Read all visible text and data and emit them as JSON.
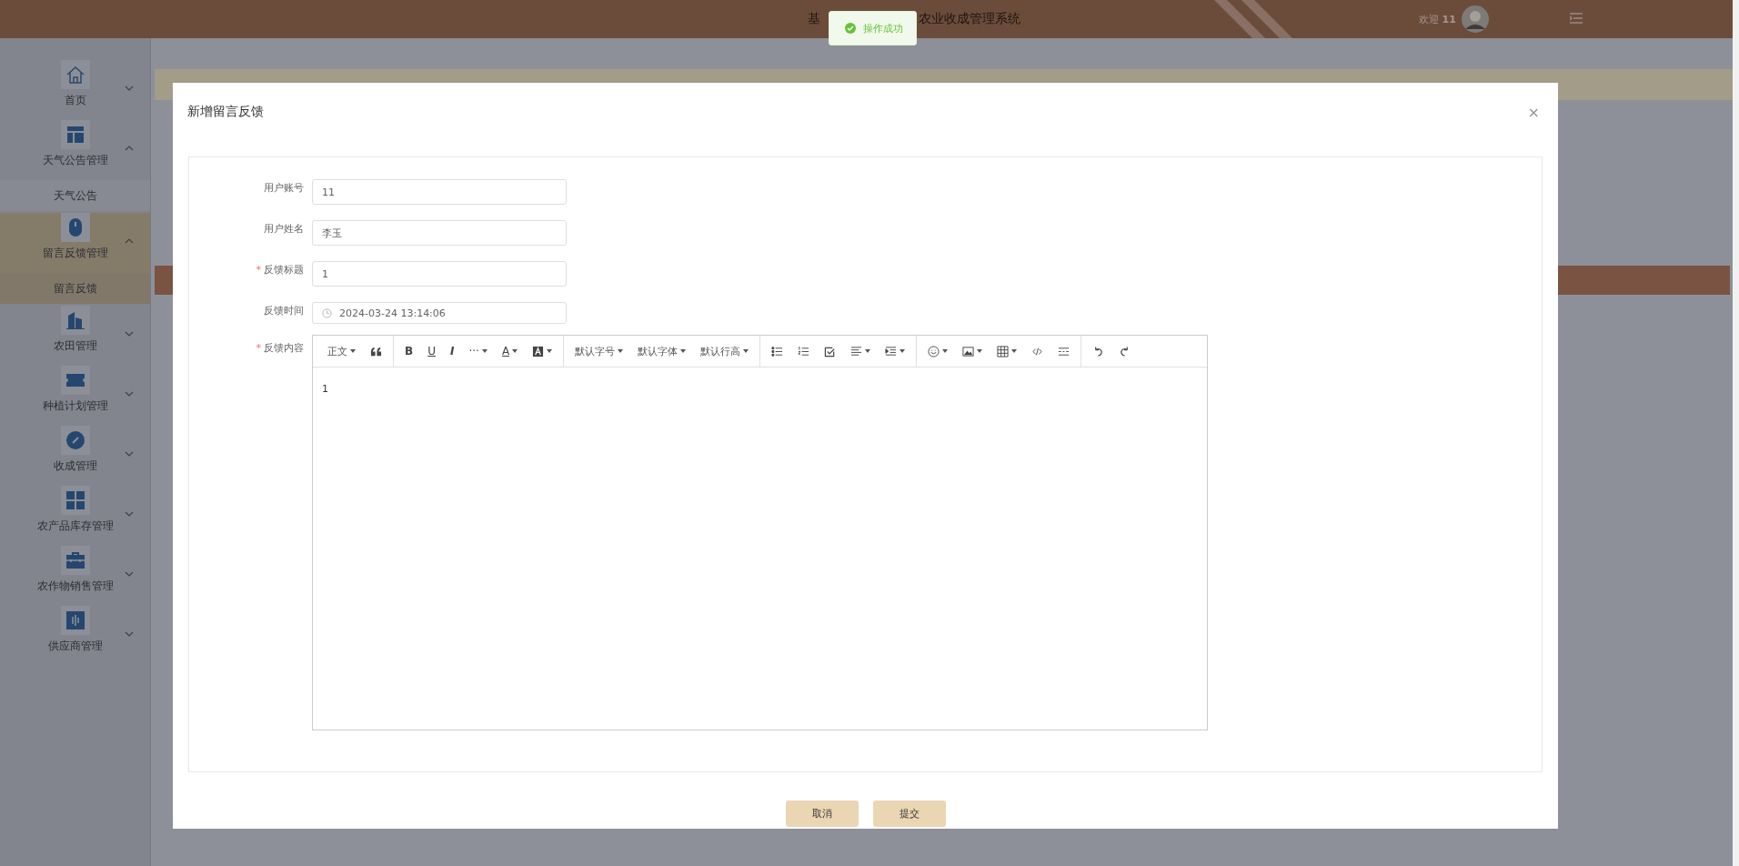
{
  "header": {
    "title_start": "基",
    "title_end": "农业收成管理系统",
    "welcome": "欢迎 **11**"
  },
  "toast": {
    "text": "操作成功"
  },
  "sidebar": {
    "items": [
      {
        "label": "首页",
        "expanded": false,
        "selected": false
      },
      {
        "label": "天气公告管理",
        "expanded": true,
        "selected": false,
        "children": [
          {
            "label": "天气公告",
            "selected": false
          }
        ]
      },
      {
        "label": "留言反馈管理",
        "expanded": true,
        "selected": true,
        "children": [
          {
            "label": "留言反馈",
            "selected": true
          }
        ]
      },
      {
        "label": "农田管理",
        "expanded": false,
        "selected": false
      },
      {
        "label": "种植计划管理",
        "expanded": false,
        "selected": false
      },
      {
        "label": "收成管理",
        "expanded": false,
        "selected": false
      },
      {
        "label": "农产品库存管理",
        "expanded": false,
        "selected": false
      },
      {
        "label": "农作物销售管理",
        "expanded": false,
        "selected": false
      },
      {
        "label": "供应商管理",
        "expanded": false,
        "selected": false
      }
    ]
  },
  "dialog": {
    "title": "新增留言反馈",
    "close": "×",
    "fields": [
      {
        "label": "用户账号",
        "kind": "text",
        "value": "11"
      },
      {
        "label": "用户姓名",
        "kind": "text",
        "value": "李玉"
      },
      {
        "label": "反馈标题",
        "required_mark": "*",
        "kind": "text",
        "value": "1"
      },
      {
        "label": "反馈时间",
        "kind": "date",
        "value": "2024-03-24 13:14:06"
      }
    ],
    "editor": {
      "label": "反馈内容",
      "required_mark": "*",
      "content": "1",
      "toolbar": [
        [
          {
            "kind": "text",
            "label": "正文",
            "dropdown": true
          },
          {
            "kind": "icon",
            "dropdown": false
          }
        ],
        [
          {
            "kind": "glyph",
            "label": "B",
            "dropdown": false
          },
          {
            "kind": "glyph",
            "label": "U",
            "dropdown": false
          },
          {
            "kind": "glyph",
            "label": "I",
            "dropdown": false
          },
          {
            "kind": "glyph",
            "label": "···",
            "dropdown": true
          },
          {
            "kind": "glyph",
            "label": "A",
            "dropdown": true
          },
          {
            "kind": "icon",
            "dropdown": true
          }
        ],
        [
          {
            "kind": "text",
            "label": "默认字号",
            "dropdown": true
          },
          {
            "kind": "text",
            "label": "默认字体",
            "dropdown": true
          },
          {
            "kind": "text",
            "label": "默认行高",
            "dropdown": true
          }
        ],
        [
          {
            "kind": "icon",
            "dropdown": false
          },
          {
            "kind": "icon",
            "dropdown": false
          },
          {
            "kind": "icon",
            "dropdown": false
          },
          {
            "kind": "icon",
            "dropdown": true
          },
          {
            "kind": "icon",
            "dropdown": true
          }
        ],
        [
          {
            "kind": "icon",
            "dropdown": true
          },
          {
            "kind": "icon",
            "dropdown": true
          },
          {
            "kind": "icon",
            "dropdown": true
          },
          {
            "kind": "icon",
            "dropdown": false
          },
          {
            "kind": "icon",
            "dropdown": false
          }
        ],
        [
          {
            "kind": "icon",
            "dropdown": false
          },
          {
            "kind": "icon",
            "dropdown": false
          }
        ]
      ]
    },
    "buttons": [
      "取消",
      "提交"
    ]
  }
}
